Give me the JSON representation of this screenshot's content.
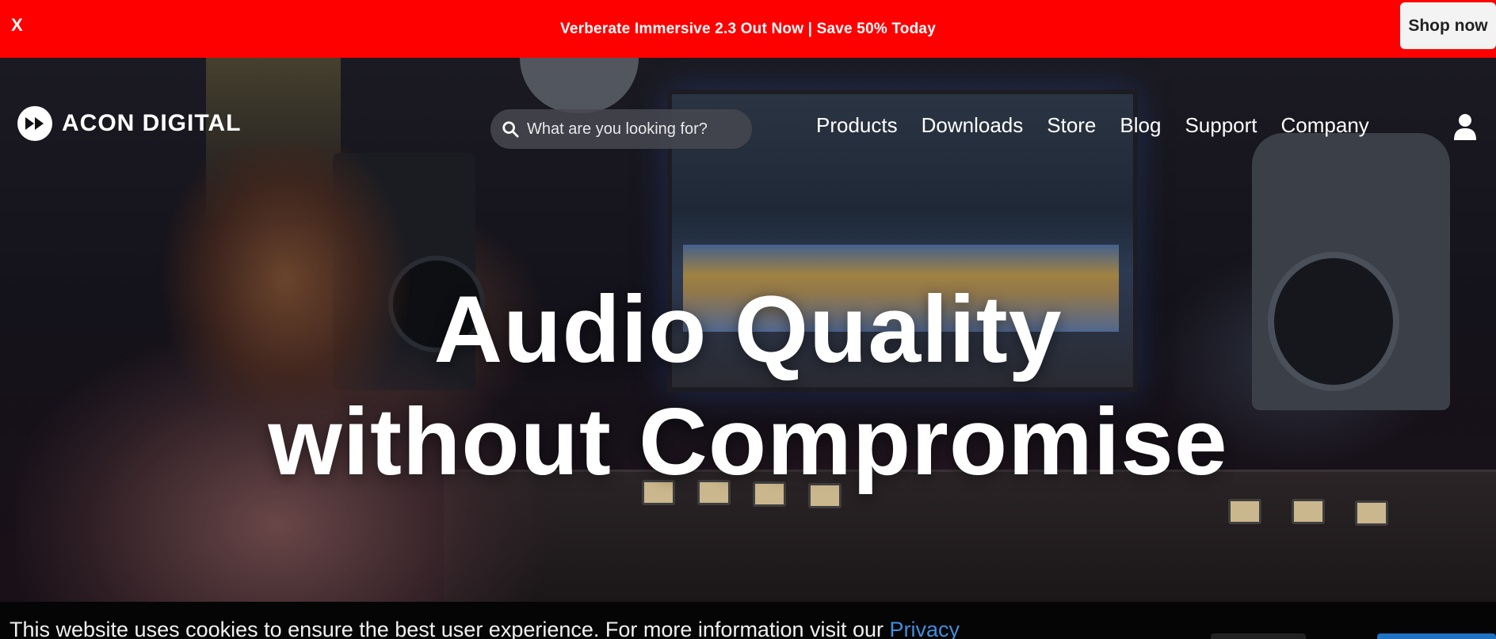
{
  "promo": {
    "close_label": "X",
    "text": "Verberate Immersive 2.3 Out Now | Save 50% Today",
    "button_label": "Shop now",
    "bg_color": "#fe0000"
  },
  "header": {
    "brand": "ACON DIGITAL",
    "search_placeholder": "What are you looking for?",
    "nav": [
      "Products",
      "Downloads",
      "Store",
      "Blog",
      "Support",
      "Company"
    ],
    "account_icon": "user-icon"
  },
  "hero": {
    "headline_line1": "Audio Quality",
    "headline_line2": "without Compromise"
  },
  "cookie": {
    "text": "This website uses cookies to ensure the best user experience. For more information visit our ",
    "link_label": "Privacy",
    "link_color": "#3f8edc"
  }
}
